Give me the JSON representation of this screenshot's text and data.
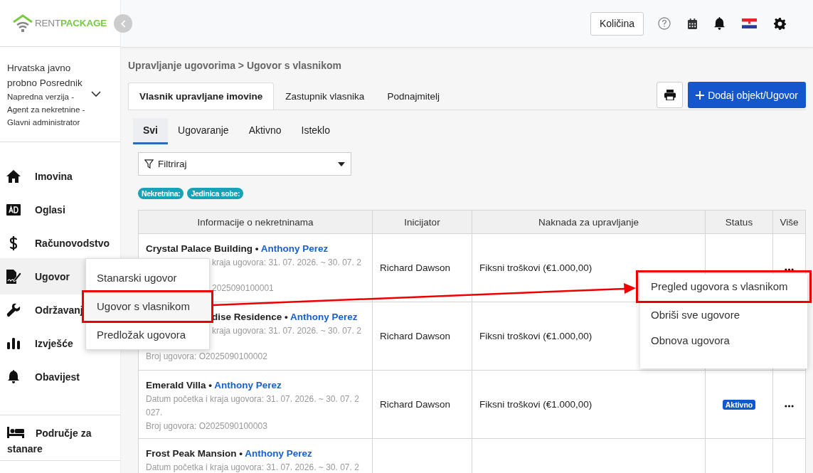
{
  "brand": {
    "word1": "RENT",
    "word2": "PACKAGE"
  },
  "account": {
    "name": "Hrvatska javno probno Posrednik",
    "role": "Napredna verzija - Agent za nekretnine - Glavni administrator"
  },
  "nav": [
    {
      "label": "Imovina",
      "selected": false
    },
    {
      "label": "Oglasi",
      "selected": false
    },
    {
      "label": "Računovodstvo",
      "selected": false
    },
    {
      "label": "Ugovor",
      "selected": true
    },
    {
      "label": "Održavanj",
      "selected": false
    },
    {
      "label": "Izvješće",
      "selected": false
    },
    {
      "label": "Obavijest",
      "selected": false
    }
  ],
  "tenant_area": {
    "label": "Područje za stanare"
  },
  "topbar": {
    "quantity_button": "Količina"
  },
  "breadcrumb": "Upravljanje ugovorima > Ugovor s vlasnikom",
  "tabs": [
    {
      "label": "Vlasnik upravljane imovine",
      "selected": true
    },
    {
      "label": "Zastupnik vlasnika",
      "selected": false
    },
    {
      "label": "Podnajmitelj",
      "selected": false
    }
  ],
  "add_button": "Dodaj objekt/Ugovor",
  "subtabs": [
    {
      "label": "Svi",
      "selected": true
    },
    {
      "label": "Ugovaranje",
      "selected": false
    },
    {
      "label": "Aktivno",
      "selected": false
    },
    {
      "label": "Isteklo",
      "selected": false
    }
  ],
  "filter": {
    "label": "Filtriraj"
  },
  "tags": [
    "Nekretnina:",
    "Jedinica sobe:"
  ],
  "table": {
    "columns": [
      "Informacije o nekretninama",
      "Inicijator",
      "Naknada za upravljanje",
      "Status",
      "Više"
    ],
    "separator": "•",
    "rows": [
      {
        "name": "Crystal Palace Building",
        "owner": "Anthony Perez",
        "name_clipped": false,
        "lines": [
          {
            "kind": "date",
            "text": "kraja ugovora: 31. 07. 2026. ~ 30. 07. 2",
            "clipped": true
          },
          {
            "kind": "number",
            "text": "2025090100001",
            "clipped": true
          }
        ],
        "initiator": "Richard Dawson",
        "fee": "Fiksni troškovi (€1.000,00)",
        "more": true
      },
      {
        "name": "dise Residence",
        "owner": "Anthony Perez",
        "name_clipped": true,
        "lines": [
          {
            "kind": "date",
            "text": "kraja ugovora: 31. 07. 2026. ~ 30. 07. 2",
            "clipped": true
          },
          {
            "kind": "number",
            "text": "Broj ugovora: O2025090100002",
            "clipped": false
          }
        ],
        "initiator": "Richard Dawson",
        "fee": "Fiksni troškovi (€1.000,00)",
        "more": false
      },
      {
        "name": "Emerald Villa",
        "owner": "Anthony Perez",
        "name_clipped": false,
        "lines": [
          {
            "kind": "date",
            "text": "Datum početka i kraja ugovora: 31. 07. 2026. ~ 30. 07. 2",
            "clipped": false
          },
          {
            "kind": "date",
            "text": "027.",
            "clipped": false
          },
          {
            "kind": "number",
            "text": "Broj ugovora: O2025090100003",
            "clipped": false
          }
        ],
        "initiator": "Richard Dawson",
        "fee": "Fiksni troškovi (€1.000,00)",
        "status": {
          "label": "Aktivno",
          "kind": "active"
        },
        "more": true
      },
      {
        "name": "Frost Peak Mansion",
        "owner": "Anthony Perez",
        "name_clipped": false,
        "lines": [
          {
            "kind": "date",
            "text": "Datum početka i kraja ugovora: 31. 07. 2026. ~ 30. 07. 2",
            "clipped": false
          }
        ],
        "more": false
      }
    ]
  },
  "submenu": {
    "items": [
      {
        "label": "Stanarski ugovor",
        "highlighted": false
      },
      {
        "label": "Ugovor s vlasnikom",
        "highlighted": true
      },
      {
        "label": "Predložak ugovora",
        "highlighted": false
      }
    ]
  },
  "row_menu": {
    "items": [
      {
        "label": "Pregled ugovora s vlasnikom",
        "highlighted": true
      },
      {
        "label": "Obriši sve ugovore",
        "highlighted": false
      },
      {
        "label": "Obnova ugovora",
        "highlighted": false
      }
    ]
  }
}
